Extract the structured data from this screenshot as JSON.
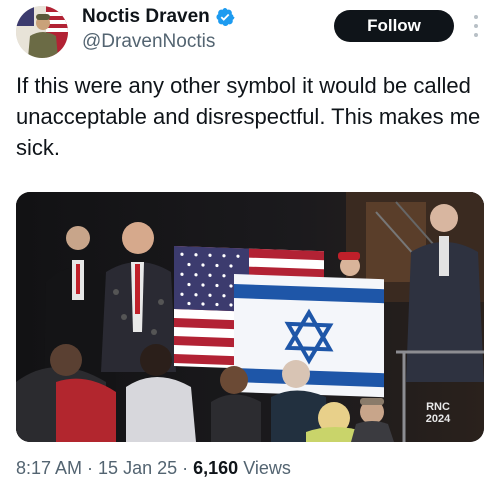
{
  "author": {
    "display_name": "Noctis Draven",
    "handle": "@DravenNoctis",
    "verified": true,
    "avatar_icon": "profile-avatar"
  },
  "actions": {
    "follow_label": "Follow",
    "more_icon": "more-vertical-icon"
  },
  "tweet": {
    "text": "If this were any other symbol it would be called unacceptable and disrespectful. This makes me sick."
  },
  "media": {
    "watermark_line1": "RNC",
    "watermark_line2": "2024"
  },
  "meta": {
    "time": "8:17 AM",
    "date": "15 Jan 25",
    "views_count": "6,160",
    "views_label": "Views"
  },
  "colors": {
    "follow_bg": "#0f1419",
    "verified": "#1d9bf0",
    "secondary_text": "#536471"
  }
}
